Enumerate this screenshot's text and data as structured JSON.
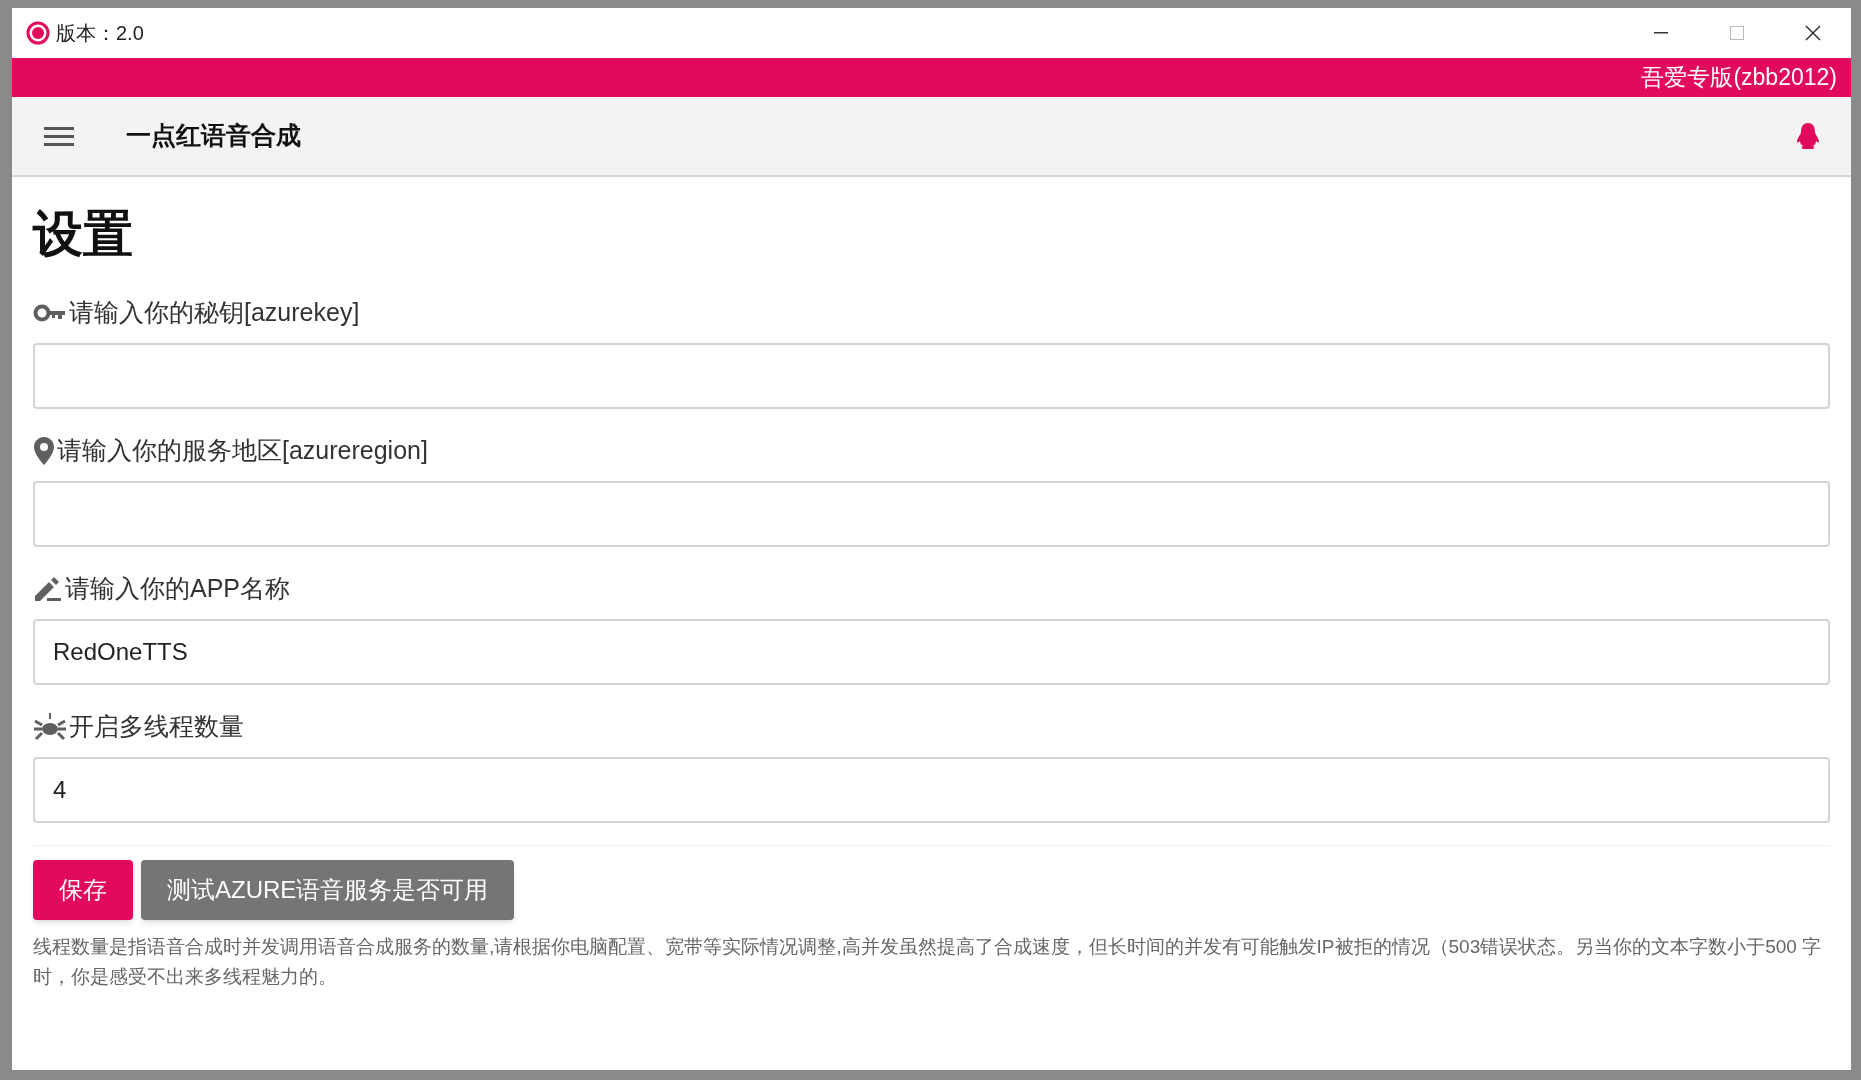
{
  "window": {
    "title": "版本：2.0"
  },
  "banner": {
    "text": "吾爱专版(zbb2012)"
  },
  "app_bar": {
    "title": "一点红语音合成"
  },
  "page": {
    "heading": "设置"
  },
  "fields": [
    {
      "kind": "key",
      "label": "请输入你的秘钥[azurekey]"
    },
    {
      "kind": "pin",
      "label": "请输入你的服务地区[azureregion]"
    },
    {
      "kind": "pencil",
      "label": "请输入你的APP名称",
      "value": "RedOneTTS"
    },
    {
      "kind": "bug",
      "label": "开启多线程数量",
      "value": "4"
    }
  ],
  "buttons": [
    {
      "label": "保存",
      "kind": "primary"
    },
    {
      "label": "测试AZURE语音服务是否可用",
      "kind": "secondary"
    }
  ],
  "note": "线程数量是指语音合成时并发调用语音合成服务的数量,请根据你电脑配置、宽带等实际情况调整,高并发虽然提高了合成速度，但长时间的并发有可能触发IP被拒的情况（503错误状态。另当你的文本字数小于500 字时，你是感受不出来多线程魅力的。"
}
